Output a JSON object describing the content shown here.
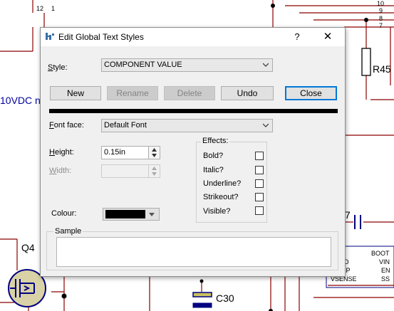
{
  "background": {
    "labels": {
      "pin12": "12",
      "pin1": "1",
      "pin10": "10",
      "pin9": "9",
      "pin8": "8",
      "pin7": "7",
      "r45": "R45",
      "vdc": "10VDC n",
      "q4": "Q4",
      "c30": "C30",
      "cap7": "7",
      "boot": "BOOT",
      "vin": "VIN",
      "en": "EN",
      "ss": "SS",
      "vsense": "VSENSE",
      "d_frag": "D",
      "mp_frag": "MP"
    },
    "colors": {
      "wire": "#8b0000",
      "component": "#000080",
      "label": "#0000a0"
    }
  },
  "dialog": {
    "title": "Edit Global Text Styles",
    "help": "?",
    "close_glyph": "✕",
    "style_label": "Style:",
    "style_value": "COMPONENT VALUE",
    "buttons": {
      "new": "New",
      "rename": "Rename",
      "delete": "Delete",
      "undo": "Undo",
      "close": "Close"
    },
    "font_face_label": "Font face:",
    "font_face_value": "Default Font",
    "height_label": "Height:",
    "height_value": "0.15in",
    "width_label": "Width:",
    "width_value": "",
    "colour_label": "Colour:",
    "colour_value": "#000000",
    "effects": {
      "legend": "Effects:",
      "bold": "Bold?",
      "italic": "Italic?",
      "underline": "Underline?",
      "strikeout": "Strikeout?",
      "visible": "Visible?"
    },
    "sample_label": "Sample",
    "accent": "#0078d7"
  }
}
